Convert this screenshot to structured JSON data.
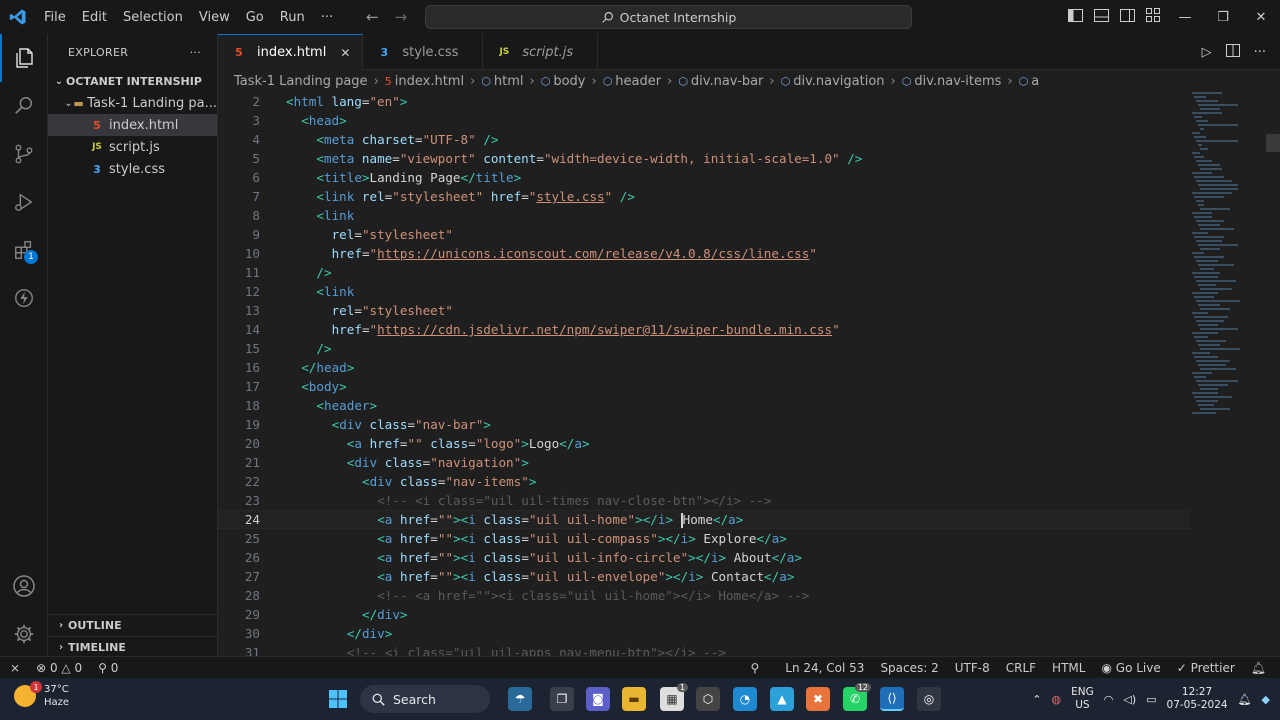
{
  "titlebar": {
    "menu": [
      "File",
      "Edit",
      "Selection",
      "View",
      "Go",
      "Run",
      "···"
    ],
    "search_text": "Octanet Internship"
  },
  "activitybar": {
    "extensions_badge": "1"
  },
  "sidebar": {
    "header": "EXPLORER",
    "header_more": "···",
    "root": "OCTANET INTERNSHIP",
    "folder": "Task-1 Landing pa...",
    "files": [
      {
        "name": "index.html",
        "icon": "5",
        "color": "#e44d26"
      },
      {
        "name": "script.js",
        "icon": "JS",
        "color": "#cbcb41"
      },
      {
        "name": "style.css",
        "icon": "3",
        "color": "#42a5f5"
      }
    ],
    "outline": "OUTLINE",
    "timeline": "TIMELINE"
  },
  "tabs": [
    {
      "name": "index.html",
      "icon": "5",
      "color": "#e44d26",
      "close": "✕"
    },
    {
      "name": "style.css",
      "icon": "3",
      "color": "#42a5f5"
    },
    {
      "name": "script.js",
      "icon": "JS",
      "color": "#cbcb41"
    }
  ],
  "breadcrumb": [
    "Task-1 Landing page",
    "index.html",
    "html",
    "body",
    "header",
    "div.nav-bar",
    "div.navigation",
    "div.nav-items",
    "a"
  ],
  "editor": {
    "current_line": 24,
    "lines": [
      {
        "n": 2,
        "indent": 0,
        "segs": [
          [
            "tg",
            "<"
          ],
          [
            "tn",
            "html"
          ],
          [
            "at",
            " lang"
          ],
          [
            "tx",
            "="
          ],
          [
            "st",
            "\"en\""
          ],
          [
            "tg",
            ">"
          ]
        ]
      },
      {
        "n": 3,
        "indent": 1,
        "segs": [
          [
            "tg",
            "<"
          ],
          [
            "tn",
            "head"
          ],
          [
            "tg",
            ">"
          ]
        ]
      },
      {
        "n": 4,
        "indent": 2,
        "segs": [
          [
            "tg",
            "<"
          ],
          [
            "tn",
            "meta"
          ],
          [
            "at",
            " charset"
          ],
          [
            "tx",
            "="
          ],
          [
            "st",
            "\"UTF-8\""
          ],
          [
            "tg",
            " />"
          ]
        ]
      },
      {
        "n": 5,
        "indent": 2,
        "segs": [
          [
            "tg",
            "<"
          ],
          [
            "tn",
            "meta"
          ],
          [
            "at",
            " name"
          ],
          [
            "tx",
            "="
          ],
          [
            "st",
            "\"viewport\""
          ],
          [
            "at",
            " content"
          ],
          [
            "tx",
            "="
          ],
          [
            "st",
            "\"width=device-width, initial-scale=1.0\""
          ],
          [
            "tg",
            " />"
          ]
        ]
      },
      {
        "n": 6,
        "indent": 2,
        "segs": [
          [
            "tg",
            "<"
          ],
          [
            "tn",
            "title"
          ],
          [
            "tg",
            ">"
          ],
          [
            "tx",
            "Landing Page"
          ],
          [
            "tg",
            "</"
          ],
          [
            "tn",
            "title"
          ],
          [
            "tg",
            ">"
          ]
        ]
      },
      {
        "n": 7,
        "indent": 2,
        "segs": [
          [
            "tg",
            "<"
          ],
          [
            "tn",
            "link"
          ],
          [
            "at",
            " rel"
          ],
          [
            "tx",
            "="
          ],
          [
            "st",
            "\"stylesheet\""
          ],
          [
            "at",
            " href"
          ],
          [
            "tx",
            "="
          ],
          [
            "st",
            "\""
          ],
          [
            "stu",
            "style.css"
          ],
          [
            "st",
            "\""
          ],
          [
            "tg",
            " />"
          ]
        ]
      },
      {
        "n": 8,
        "indent": 2,
        "segs": [
          [
            "tg",
            "<"
          ],
          [
            "tn",
            "link"
          ]
        ]
      },
      {
        "n": 9,
        "indent": 3,
        "segs": [
          [
            "at",
            "rel"
          ],
          [
            "tx",
            "="
          ],
          [
            "st",
            "\"stylesheet\""
          ]
        ]
      },
      {
        "n": 10,
        "indent": 3,
        "segs": [
          [
            "at",
            "href"
          ],
          [
            "tx",
            "="
          ],
          [
            "st",
            "\""
          ],
          [
            "stu",
            "https://unicons.iconscout.com/release/v4.0.8/css/line.css"
          ],
          [
            "st",
            "\""
          ]
        ]
      },
      {
        "n": 11,
        "indent": 2,
        "segs": [
          [
            "tg",
            "/>"
          ]
        ]
      },
      {
        "n": 12,
        "indent": 2,
        "segs": [
          [
            "tg",
            "<"
          ],
          [
            "tn",
            "link"
          ]
        ]
      },
      {
        "n": 13,
        "indent": 3,
        "segs": [
          [
            "at",
            "rel"
          ],
          [
            "tx",
            "="
          ],
          [
            "st",
            "\"stylesheet\""
          ]
        ]
      },
      {
        "n": 14,
        "indent": 3,
        "segs": [
          [
            "at",
            "href"
          ],
          [
            "tx",
            "="
          ],
          [
            "st",
            "\""
          ],
          [
            "stu",
            "https://cdn.jsdelivr.net/npm/swiper@11/swiper-bundle.min.css"
          ],
          [
            "st",
            "\""
          ]
        ]
      },
      {
        "n": 15,
        "indent": 2,
        "segs": [
          [
            "tg",
            "/>"
          ]
        ]
      },
      {
        "n": 16,
        "indent": 1,
        "segs": [
          [
            "tg",
            "</"
          ],
          [
            "tn",
            "head"
          ],
          [
            "tg",
            ">"
          ]
        ]
      },
      {
        "n": 17,
        "indent": 1,
        "segs": [
          [
            "tg",
            "<"
          ],
          [
            "tn",
            "body"
          ],
          [
            "tg",
            ">"
          ]
        ]
      },
      {
        "n": 18,
        "indent": 2,
        "segs": [
          [
            "tg",
            "<"
          ],
          [
            "tn",
            "header"
          ],
          [
            "tg",
            ">"
          ]
        ]
      },
      {
        "n": 19,
        "indent": 3,
        "segs": [
          [
            "tg",
            "<"
          ],
          [
            "tn",
            "div"
          ],
          [
            "at",
            " class"
          ],
          [
            "tx",
            "="
          ],
          [
            "st",
            "\"nav-bar\""
          ],
          [
            "tg",
            ">"
          ]
        ]
      },
      {
        "n": 20,
        "indent": 4,
        "segs": [
          [
            "tg",
            "<"
          ],
          [
            "tn",
            "a"
          ],
          [
            "at",
            " href"
          ],
          [
            "tx",
            "="
          ],
          [
            "st",
            "\"\""
          ],
          [
            "at",
            " class"
          ],
          [
            "tx",
            "="
          ],
          [
            "st",
            "\"logo\""
          ],
          [
            "tg",
            ">"
          ],
          [
            "tx",
            "Logo"
          ],
          [
            "tg",
            "</"
          ],
          [
            "tn",
            "a"
          ],
          [
            "tg",
            ">"
          ]
        ]
      },
      {
        "n": 21,
        "indent": 4,
        "segs": [
          [
            "tg",
            "<"
          ],
          [
            "tn",
            "div"
          ],
          [
            "at",
            " class"
          ],
          [
            "tx",
            "="
          ],
          [
            "st",
            "\"navigation\""
          ],
          [
            "tg",
            ">"
          ]
        ]
      },
      {
        "n": 22,
        "indent": 5,
        "segs": [
          [
            "tg",
            "<"
          ],
          [
            "tn",
            "div"
          ],
          [
            "at",
            " class"
          ],
          [
            "tx",
            "="
          ],
          [
            "st",
            "\"nav-items\""
          ],
          [
            "tg",
            ">"
          ]
        ]
      },
      {
        "n": 23,
        "indent": 6,
        "segs": [
          [
            "cm",
            "<!-- <i class=\"uil uil-times nav-close-btn\"></i> -->"
          ]
        ]
      },
      {
        "n": 24,
        "indent": 6,
        "segs": [
          [
            "tg",
            "<"
          ],
          [
            "tn",
            "a"
          ],
          [
            "at",
            " href"
          ],
          [
            "tx",
            "="
          ],
          [
            "st",
            "\"\""
          ],
          [
            "tg",
            ">"
          ],
          [
            "tg",
            "<"
          ],
          [
            "tn",
            "i"
          ],
          [
            "at",
            " class"
          ],
          [
            "tx",
            "="
          ],
          [
            "st",
            "\"uil uil-home\""
          ],
          [
            "tg",
            ">"
          ],
          [
            "tg",
            "</"
          ],
          [
            "tn",
            "i"
          ],
          [
            "tg",
            ">"
          ],
          [
            "tx",
            " "
          ],
          [
            "cursor",
            ""
          ],
          [
            "tx",
            "Home"
          ],
          [
            "tg",
            "</"
          ],
          [
            "tn",
            "a"
          ],
          [
            "tg",
            ">"
          ]
        ]
      },
      {
        "n": 25,
        "indent": 6,
        "segs": [
          [
            "tg",
            "<"
          ],
          [
            "tn",
            "a"
          ],
          [
            "at",
            " href"
          ],
          [
            "tx",
            "="
          ],
          [
            "st",
            "\"\""
          ],
          [
            "tg",
            ">"
          ],
          [
            "tg",
            "<"
          ],
          [
            "tn",
            "i"
          ],
          [
            "at",
            " class"
          ],
          [
            "tx",
            "="
          ],
          [
            "st",
            "\"uil uil-compass\""
          ],
          [
            "tg",
            ">"
          ],
          [
            "tg",
            "</"
          ],
          [
            "tn",
            "i"
          ],
          [
            "tg",
            ">"
          ],
          [
            "tx",
            " Explore"
          ],
          [
            "tg",
            "</"
          ],
          [
            "tn",
            "a"
          ],
          [
            "tg",
            ">"
          ]
        ]
      },
      {
        "n": 26,
        "indent": 6,
        "segs": [
          [
            "tg",
            "<"
          ],
          [
            "tn",
            "a"
          ],
          [
            "at",
            " href"
          ],
          [
            "tx",
            "="
          ],
          [
            "st",
            "\"\""
          ],
          [
            "tg",
            ">"
          ],
          [
            "tg",
            "<"
          ],
          [
            "tn",
            "i"
          ],
          [
            "at",
            " class"
          ],
          [
            "tx",
            "="
          ],
          [
            "st",
            "\"uil uil-info-circle\""
          ],
          [
            "tg",
            ">"
          ],
          [
            "tg",
            "</"
          ],
          [
            "tn",
            "i"
          ],
          [
            "tg",
            ">"
          ],
          [
            "tx",
            " About"
          ],
          [
            "tg",
            "</"
          ],
          [
            "tn",
            "a"
          ],
          [
            "tg",
            ">"
          ]
        ]
      },
      {
        "n": 27,
        "indent": 6,
        "segs": [
          [
            "tg",
            "<"
          ],
          [
            "tn",
            "a"
          ],
          [
            "at",
            " href"
          ],
          [
            "tx",
            "="
          ],
          [
            "st",
            "\"\""
          ],
          [
            "tg",
            ">"
          ],
          [
            "tg",
            "<"
          ],
          [
            "tn",
            "i"
          ],
          [
            "at",
            " class"
          ],
          [
            "tx",
            "="
          ],
          [
            "st",
            "\"uil uil-envelope\""
          ],
          [
            "tg",
            ">"
          ],
          [
            "tg",
            "</"
          ],
          [
            "tn",
            "i"
          ],
          [
            "tg",
            ">"
          ],
          [
            "tx",
            " Contact"
          ],
          [
            "tg",
            "</"
          ],
          [
            "tn",
            "a"
          ],
          [
            "tg",
            ">"
          ]
        ]
      },
      {
        "n": 28,
        "indent": 6,
        "segs": [
          [
            "cm",
            "<!-- <a href=\"\"><i class=\"uil uil-home\"></i> Home</a> -->"
          ]
        ]
      },
      {
        "n": 29,
        "indent": 5,
        "segs": [
          [
            "tg",
            "</"
          ],
          [
            "tn",
            "div"
          ],
          [
            "tg",
            ">"
          ]
        ]
      },
      {
        "n": 30,
        "indent": 4,
        "segs": [
          [
            "tg",
            "</"
          ],
          [
            "tn",
            "div"
          ],
          [
            "tg",
            ">"
          ]
        ]
      },
      {
        "n": 31,
        "indent": 4,
        "segs": [
          [
            "cm",
            "<!-- <i class=\"uil uil-apps nav-menu-btn\"></i> -->"
          ]
        ]
      }
    ]
  },
  "statusbar": {
    "errors": "0",
    "warnings": "0",
    "ports": "0",
    "position": "Ln 24, Col 53",
    "spaces": "Spaces: 2",
    "encoding": "UTF-8",
    "eol": "CRLF",
    "language": "HTML",
    "golive": "Go Live",
    "prettier": "Prettier"
  },
  "taskbar": {
    "temp": "37°C",
    "weather": "Haze",
    "weather_badge": "1",
    "search": "Search",
    "lang1": "ENG",
    "lang2": "US",
    "time": "12:27",
    "date": "07-05-2024",
    "whatsapp_badge": "12",
    "store_badge": "1"
  }
}
